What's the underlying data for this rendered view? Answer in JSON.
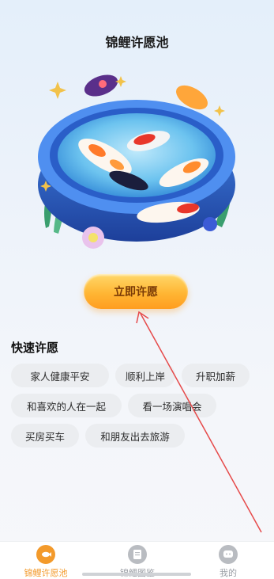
{
  "header": {
    "title": "锦鲤许愿池"
  },
  "hero": {
    "illustration": "koi-pond-illustration"
  },
  "wish_button": {
    "label": "立即许愿"
  },
  "quick_wishes": {
    "title": "快速许愿",
    "chips": [
      {
        "label": "家人健康平安"
      },
      {
        "label": "顺利上岸"
      },
      {
        "label": "升职加薪"
      },
      {
        "label": "和喜欢的人在一起"
      },
      {
        "label": "看一场演唱会"
      },
      {
        "label": "买房买车"
      },
      {
        "label": "和朋友出去旅游"
      }
    ]
  },
  "tabbar": {
    "tabs": [
      {
        "label": "锦鲤许愿池",
        "icon": "koi-icon",
        "active": true
      },
      {
        "label": "锦鲤图鉴",
        "icon": "book-icon",
        "active": false
      },
      {
        "label": "我的",
        "icon": "chat-face-icon",
        "active": false
      }
    ]
  },
  "colors": {
    "accent": "#ff9d1f",
    "active_tab": "#f39a2b",
    "inactive_tab": "#9a9ea5",
    "annotation_arrow": "#e64a4a"
  }
}
